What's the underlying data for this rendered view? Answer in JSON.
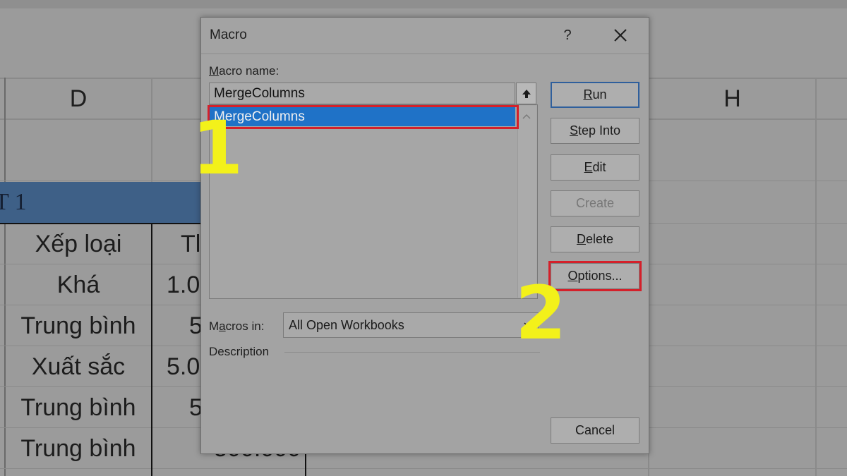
{
  "spreadsheet": {
    "column_headers": [
      "D",
      "H"
    ],
    "section_title": "T 1",
    "rows": [
      {
        "col_d": "Xếp loại",
        "col_e": "Tl"
      },
      {
        "col_d": "Khá",
        "col_e": "1.0"
      },
      {
        "col_d": "Trung bình",
        "col_e": "5"
      },
      {
        "col_d": "Xuất sắc",
        "col_e": "5.0"
      },
      {
        "col_d": "Trung bình",
        "col_e": "5"
      },
      {
        "col_d": "Trung bình",
        "col_e": "500.000"
      }
    ]
  },
  "dialog": {
    "title": "Macro",
    "help_glyph": "?",
    "close_icon": "close-icon",
    "macro_name_label_key": "M",
    "macro_name_label_rest": "acro name:",
    "macro_name_value": "MergeColumns",
    "macro_list": [
      "MergeColumns"
    ],
    "selected_macro": "MergeColumns",
    "macros_in_label_pre": "M",
    "macros_in_label_key": "a",
    "macros_in_label_rest": "cros in:",
    "macros_in_value": "All Open Workbooks",
    "description_label": "Description",
    "buttons": {
      "run_key": "R",
      "run_rest": "un",
      "step_into_key": "S",
      "step_into_rest": "tep Into",
      "edit_key": "E",
      "edit_rest": "dit",
      "create_label": "Create",
      "delete_key": "D",
      "delete_rest": "elete",
      "options_key": "O",
      "options_rest": "ptions...",
      "cancel_label": "Cancel"
    }
  },
  "annotations": {
    "step1": "1",
    "step2": "2",
    "highlight_color": "#d4202a",
    "number_color": "#f3f11a"
  }
}
